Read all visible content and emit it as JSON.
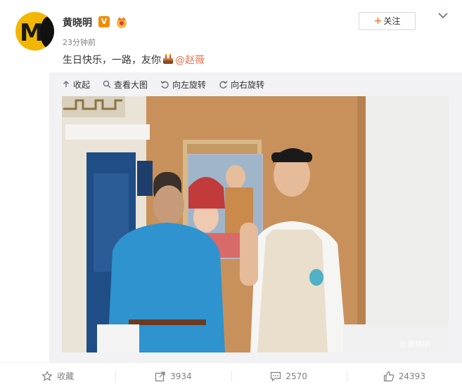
{
  "post": {
    "username": "黄晓明",
    "verified_badge": "V",
    "time": "23分钟前",
    "text_main": "生日快乐，一路，友你",
    "mention": "@赵薇",
    "follow_label": "关注",
    "follow_plus": "+"
  },
  "toolbar": {
    "collapse": "收起",
    "view_large": "查看大图",
    "rotate_left": "向左旋转",
    "rotate_right": "向右旋转"
  },
  "photo": {
    "watermark": "@黄晓明"
  },
  "footer": {
    "favorite": "收藏",
    "repost": "3934",
    "comment": "2570",
    "like": "24393"
  },
  "colors": {
    "accent_orange": "#fa7d3c",
    "mention": "#eb7350",
    "verified": "#f28c00",
    "media_bg": "#f2f2f5"
  },
  "icons": [
    "avatar",
    "verified-badge-icon",
    "crown-icon",
    "cake-emoji-icon",
    "chevron-down-icon",
    "collapse-arrow-icon",
    "search-icon",
    "rotate-left-icon",
    "rotate-right-icon",
    "star-icon",
    "repost-icon",
    "comment-icon",
    "thumb-up-icon"
  ]
}
